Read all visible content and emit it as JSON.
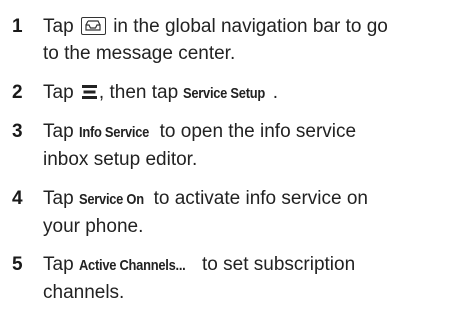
{
  "steps": [
    {
      "number": "1",
      "pre": "Tap",
      "post": "in the global navigation bar to go",
      "line2": "to the message center."
    },
    {
      "number": "2",
      "pre": "Tap",
      "mid": ", then tap",
      "keyword": "Service Setup",
      "post": "."
    },
    {
      "number": "3",
      "pre": "Tap",
      "keyword": "Info Service",
      "post": "to open the info service",
      "line2": "inbox setup editor."
    },
    {
      "number": "4",
      "pre": "Tap",
      "keyword": "Service On",
      "post": "to activate info service on",
      "line2": "your phone."
    },
    {
      "number": "5",
      "pre": "Tap",
      "keyword": "Active Channels...",
      "post": "to set subscription",
      "line2": "channels."
    }
  ],
  "icons": {
    "message_center": "message-center-icon",
    "menu": "menu-icon"
  }
}
